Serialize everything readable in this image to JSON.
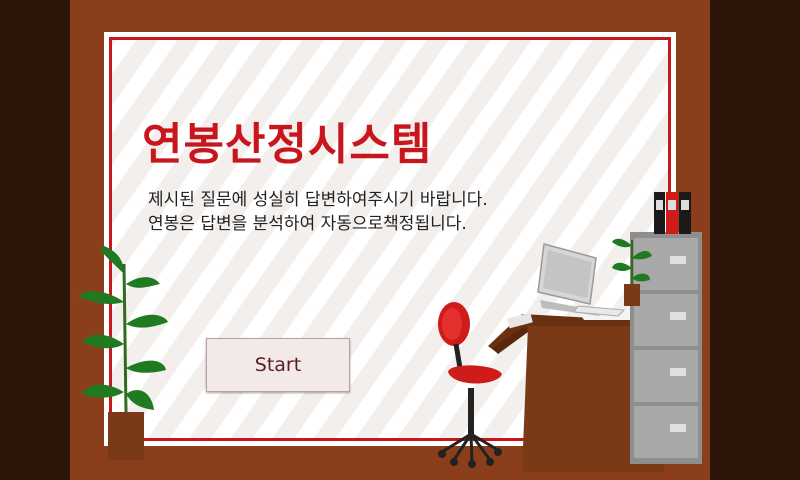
{
  "screen": {
    "title": "연봉산정시스템",
    "subtitle_line1": "제시된 질문에 성실히 답변하여주시기 바랍니다.",
    "subtitle_line2": "연봉은 답변을 분석하여 자동으로책정됩니다.",
    "start_label": "Start"
  },
  "colors": {
    "accent": "#c8161d",
    "wall": "#8a3e1c",
    "side_background": "#2a1508"
  },
  "icons": [
    "plant-icon",
    "office-chair-icon",
    "desk-icon",
    "computer-monitor-icon",
    "filing-cabinet-icon",
    "binders-icon",
    "small-plant-icon"
  ]
}
